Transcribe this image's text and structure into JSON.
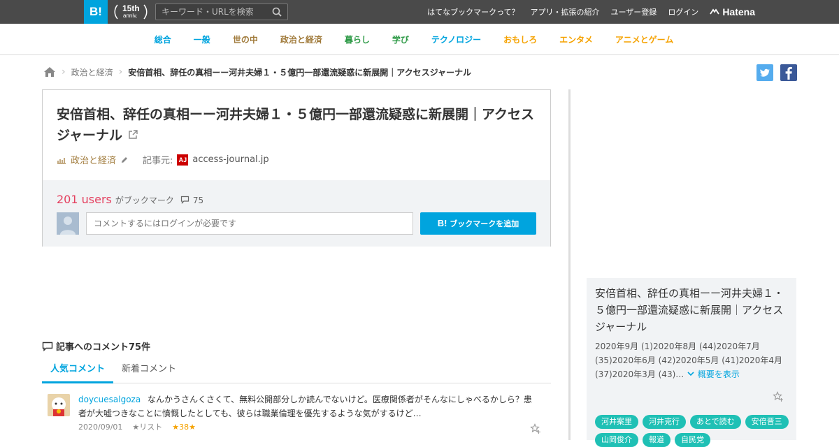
{
  "topbar": {
    "logo": "B!",
    "anniv_num": "15th",
    "anniv_text": "anniv.",
    "search_placeholder": "キーワード・URLを検索",
    "links": [
      "はてなブックマークって？",
      "アプリ・拡張の紹介",
      "ユーザー登録",
      "ログイン"
    ],
    "brand": "Hatena"
  },
  "categories": [
    {
      "label": "総合",
      "color": "#00a4de"
    },
    {
      "label": "一般",
      "color": "#00a4de"
    },
    {
      "label": "世の中",
      "color": "#a07a3a"
    },
    {
      "label": "政治と経済",
      "color": "#a07a3a"
    },
    {
      "label": "暮らし",
      "color": "#2e9a47"
    },
    {
      "label": "学び",
      "color": "#2e9a47"
    },
    {
      "label": "テクノロジー",
      "color": "#00a4de"
    },
    {
      "label": "おもしろ",
      "color": "#f5a200"
    },
    {
      "label": "エンタメ",
      "color": "#f5a200"
    },
    {
      "label": "アニメとゲーム",
      "color": "#f5a200"
    }
  ],
  "breadcrumb": {
    "category": "政治と経済",
    "current": "安倍首相、辞任の真相ーー河井夫婦１・５億円一部還流疑惑に新展開｜アクセスジャーナル"
  },
  "entry": {
    "title": "安倍首相、辞任の真相ーー河井夫婦１・５億円一部還流疑惑に新展開｜アクセスジャーナル",
    "category": "政治と経済",
    "source_label": "記事元:",
    "favicon_text": "AJ",
    "domain": "access-journal.jp",
    "users_count": "201 users",
    "users_label": "がブックマーク",
    "comment_count": "75",
    "comment_placeholder": "コメントするにはログインが必要です",
    "add_button": "ブックマークを追加"
  },
  "comments": {
    "header": "記事へのコメント75件",
    "tab_popular": "人気コメント",
    "tab_new": "新着コメント",
    "items": [
      {
        "user": "doycuesalgoza",
        "text": "なんかうさんくさくて、無料公開部分しか読んでないけど。医療関係者がそんなにしゃべるかしら？患者が大嘘つきなことに憤慨したとしても、彼らは職業倫理を優先するような気がするけど…",
        "date": "2020/09/01",
        "list_label": "★リスト",
        "stars": "★38★"
      }
    ]
  },
  "sidebar": {
    "title": "安倍首相、辞任の真相ーー河井夫婦１・５億円一部還流疑惑に新展開｜アクセスジャーナル",
    "dates": "2020年9月 (1)2020年8月 (44)2020年7月 (35)2020年6月 (42)2020年5月 (41)2020年4月 (37)2020年3月 (43)…",
    "more": "概要を表示",
    "tags": [
      "河井案里",
      "河井克行",
      "あとで読む",
      "安倍晋三",
      "山岡俊介",
      "報道",
      "自民党"
    ]
  }
}
